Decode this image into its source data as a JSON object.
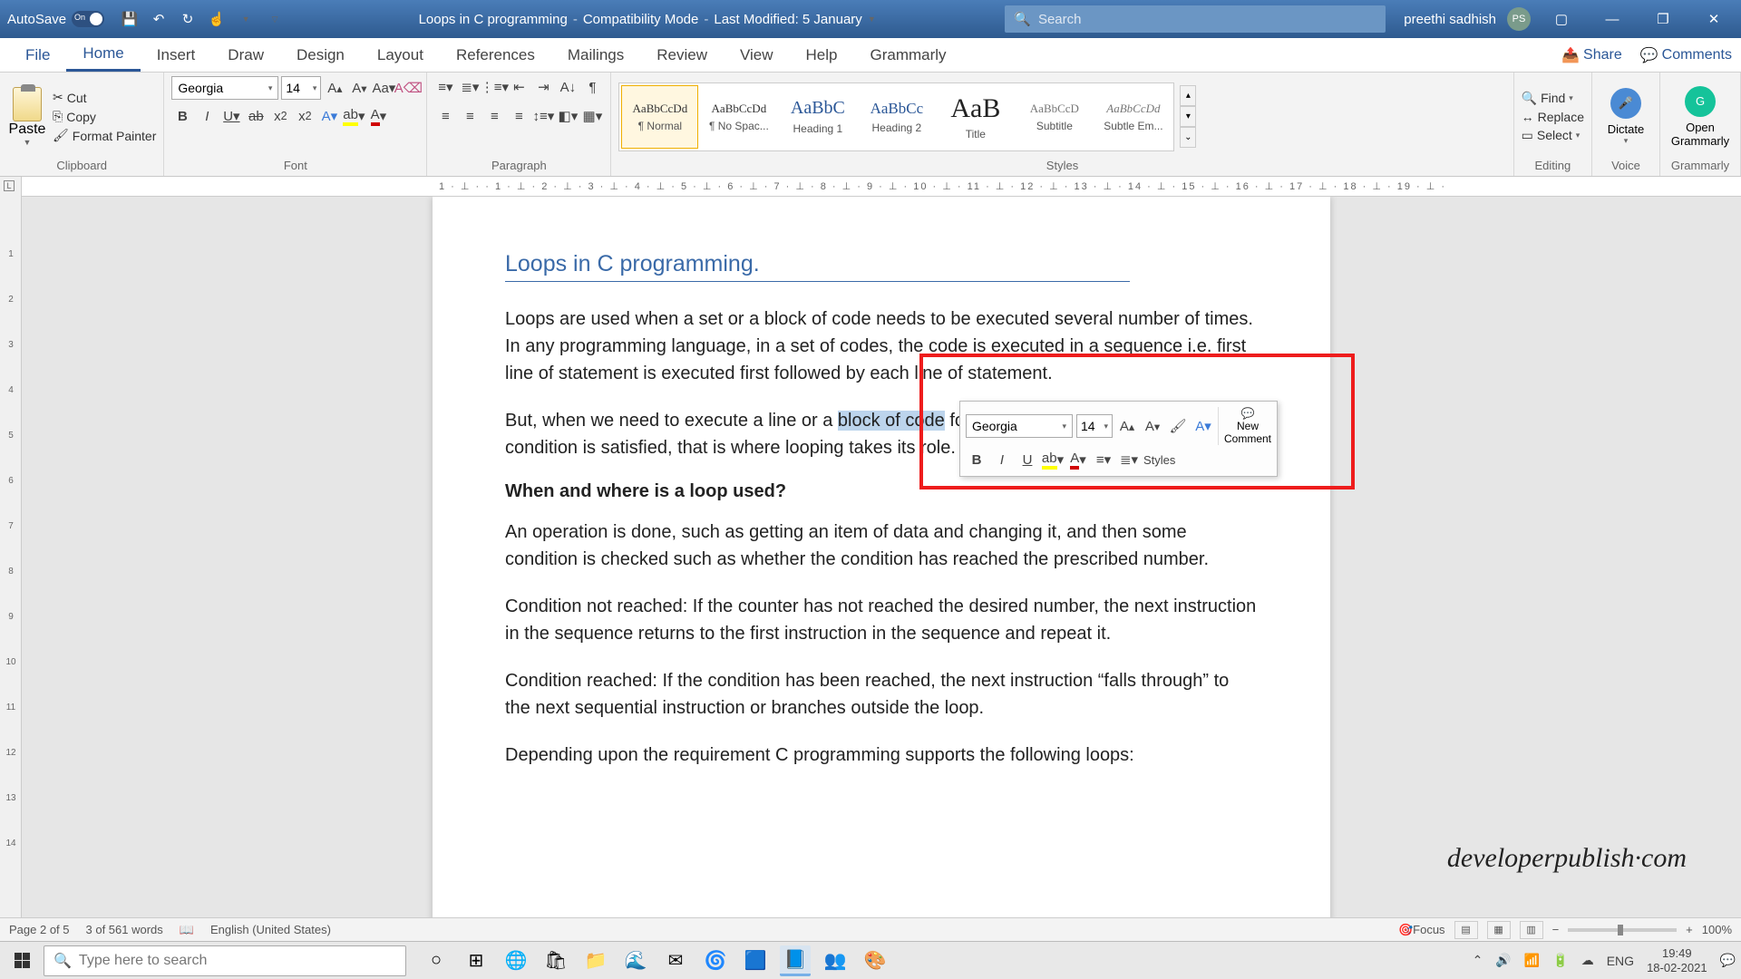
{
  "titlebar": {
    "autosave_label": "AutoSave",
    "doc_name": "Loops in C programming",
    "mode": "Compatibility Mode",
    "modified": "Last Modified: 5 January",
    "search_placeholder": "Search",
    "user_name": "preethi sadhish",
    "user_initials": "PS"
  },
  "tabs": {
    "file": "File",
    "home": "Home",
    "insert": "Insert",
    "draw": "Draw",
    "design": "Design",
    "layout": "Layout",
    "references": "References",
    "mailings": "Mailings",
    "review": "Review",
    "view": "View",
    "help": "Help",
    "grammarly": "Grammarly",
    "share": "Share",
    "comments": "Comments"
  },
  "ribbon": {
    "clipboard": {
      "paste": "Paste",
      "cut": "Cut",
      "copy": "Copy",
      "fp": "Format Painter",
      "label": "Clipboard"
    },
    "font": {
      "name": "Georgia",
      "size": "14",
      "label": "Font"
    },
    "paragraph": {
      "label": "Paragraph"
    },
    "styles": {
      "label": "Styles",
      "items": [
        {
          "preview": "AaBbCcDd",
          "name": "¶ Normal",
          "size": "13px",
          "color": "#333"
        },
        {
          "preview": "AaBbCcDd",
          "name": "¶ No Spac...",
          "size": "13px",
          "color": "#333"
        },
        {
          "preview": "AaBbC",
          "name": "Heading 1",
          "size": "20px",
          "color": "#2b5797"
        },
        {
          "preview": "AaBbCc",
          "name": "Heading 2",
          "size": "17px",
          "color": "#2b5797"
        },
        {
          "preview": "AaB",
          "name": "Title",
          "size": "30px",
          "color": "#222"
        },
        {
          "preview": "AaBbCcD",
          "name": "Subtitle",
          "size": "13px",
          "color": "#777"
        },
        {
          "preview": "AaBbCcDd",
          "name": "Subtle Em...",
          "size": "13px",
          "color": "#777",
          "italic": true
        }
      ]
    },
    "editing": {
      "find": "Find",
      "replace": "Replace",
      "select": "Select",
      "label": "Editing"
    },
    "voice": {
      "dictate": "Dictate",
      "label": "Voice"
    },
    "grammarly": {
      "open": "Open\nGrammarly",
      "label": "Grammarly"
    }
  },
  "minitoolbar": {
    "font": "Georgia",
    "size": "14",
    "styles": "Styles",
    "new_comment_1": "New",
    "new_comment_2": "Comment"
  },
  "hruler_text": "1 · ⊥ ·   · 1 ·  ⊥  · 2 ·  ⊥  · 3 ·  ⊥  · 4 ·  ⊥  · 5 ·  ⊥  · 6 ·  ⊥  · 7 ·  ⊥  · 8 ·  ⊥  · 9 ·  ⊥  · 10 ·  ⊥  · 11 ·  ⊥  · 12 ·  ⊥  · 13 ·  ⊥  · 14 ·  ⊥  · 15 ·  ⊥  · 16 ·  ⊥  · 17 ·  ⊥  · 18 ·  ⊥  · 19 ·  ⊥  ·",
  "document": {
    "title": "Loops in C programming.",
    "p1a": "Loops are used when a set or a block of code needs to be executed several number of times. In any programming language, in a set of codes, the code is executed in a sequence i.e. first line of statement is executed first followed by each line of statement.",
    "p2a": "But, when we need to execute a line or a ",
    "p2_sel": "block of code",
    "p2b": " for several times until a certain condition is satisfied, that is where looping takes its role.",
    "h2": "When and where is a loop used?",
    "p3": "An operation is done, such as getting an item of data and changing it, and then some condition is checked such as whether the condition has reached the prescribed number.",
    "p4": "Condition not reached: If the counter has not reached the desired number, the next instruction in the sequence returns to the first instruction in the sequence and repeat it.",
    "p5": "Condition reached: If the condition has been reached, the next instruction “falls through” to the next sequential instruction or branches outside the loop.",
    "p6": "Depending upon the requirement C programming supports the following loops:"
  },
  "watermark": "developerpublish·com",
  "status": {
    "page": "Page 2 of 5",
    "words": "3 of 561 words",
    "lang": "English (United States)",
    "focus": "Focus",
    "zoom": "100%"
  },
  "taskbar": {
    "search_placeholder": "Type here to search",
    "lang": "ENG",
    "time": "19:49",
    "date": "18-02-2021"
  }
}
